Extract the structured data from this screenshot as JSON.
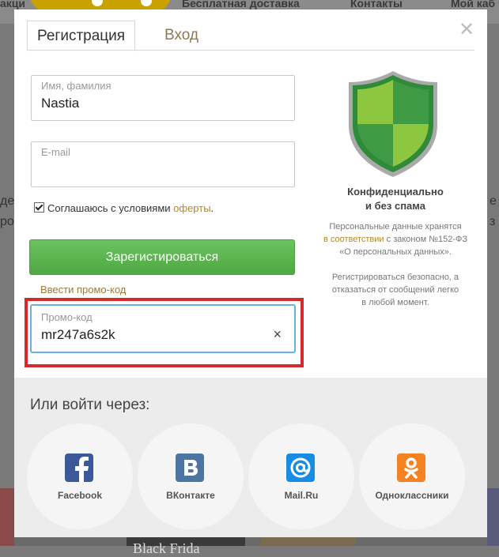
{
  "background": {
    "nav": [
      "Бесплатная доставка",
      "Контакты",
      "Мой каб"
    ],
    "left_fragment": "акци",
    "side_left": [
      "де",
      "ро"
    ],
    "side_right": [
      "е",
      "з"
    ],
    "bottom_text": "Black Frida"
  },
  "modal": {
    "tabs": [
      {
        "label": "Регистрация",
        "active": true
      },
      {
        "label": "Вход",
        "active": false
      }
    ],
    "close_icon": "close-icon",
    "fields": {
      "name": {
        "label": "Имя, фамилия",
        "value": "Nastia"
      },
      "email": {
        "label": "E-mail",
        "value": ""
      }
    },
    "agree": {
      "text": "Соглашаюсь с условиями ",
      "link": "оферты",
      "suffix": ".",
      "checked": true
    },
    "register_button": "Зарегистироваться",
    "promo_link": "Ввести промо-код",
    "promo": {
      "label": "Промо-код",
      "value": "mr247a6s2k",
      "clear_icon": "×"
    },
    "side": {
      "title_line1": "Конфиденциально",
      "title_line2": "и без спама",
      "p1_line1": "Персональные данные хранятся",
      "p1_link": "в соответствии",
      "p1_line2_rest": " с законом №152-ФЗ",
      "p1_line3": "«О персональных данных».",
      "p2_line1": "Регистрироваться безопасно, а",
      "p2_line2": "отказаться от сообщений легко",
      "p2_line3": "в любой момент."
    },
    "social": {
      "title": "Или войти через:",
      "providers": [
        {
          "name": "Facebook",
          "icon": "facebook-icon",
          "color": "#3b5998",
          "glyph": "f"
        },
        {
          "name": "ВКонтакте",
          "icon": "vk-icon",
          "color": "#4c75a3",
          "glyph": "В"
        },
        {
          "name": "Mail.Ru",
          "icon": "mailru-icon",
          "color": "#168de2",
          "glyph": "@"
        },
        {
          "name": "Одноклассники",
          "icon": "ok-icon",
          "color": "#f58220",
          "glyph": "ok"
        }
      ]
    }
  },
  "colors": {
    "accent_green": "#56b04a",
    "highlight_red": "#d42a2a",
    "focus_blue": "#66b3e0",
    "link_gold": "#b08a2a"
  }
}
